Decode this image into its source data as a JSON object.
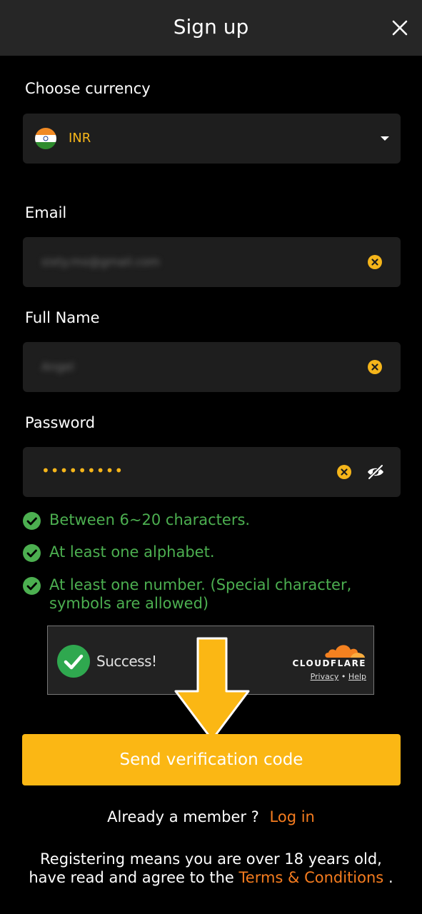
{
  "header": {
    "title": "Sign up"
  },
  "currency": {
    "label": "Choose currency",
    "value": "INR",
    "flag": "india-flag"
  },
  "email": {
    "label": "Email",
    "value": "sixty.mo@gmail.com"
  },
  "full_name": {
    "label": "Full Name",
    "value": "Angel"
  },
  "password": {
    "label": "Password",
    "value": "•••••••••"
  },
  "rules": [
    {
      "text": "Between 6~20 characters."
    },
    {
      "text": "At least one alphabet."
    },
    {
      "text": "At least one number. (Special character, symbols are allowed)"
    }
  ],
  "captcha": {
    "status": "Success!",
    "brand": "CLOUDFLARE",
    "privacy": "Privacy",
    "separator": "•",
    "help": "Help"
  },
  "submit": {
    "label": "Send verification code"
  },
  "login_prompt": {
    "question": "Already a member ?",
    "link": "Log in"
  },
  "legal": {
    "prefix": "Registering means you are over 18 years old, have read and agree to the",
    "link": "Terms & Conditions",
    "suffix": "."
  },
  "colors": {
    "accent": "#fbb714",
    "link": "#f57c1f",
    "success": "#4caf50",
    "background": "#000000",
    "field": "#1e1e1e",
    "header": "#262626"
  }
}
